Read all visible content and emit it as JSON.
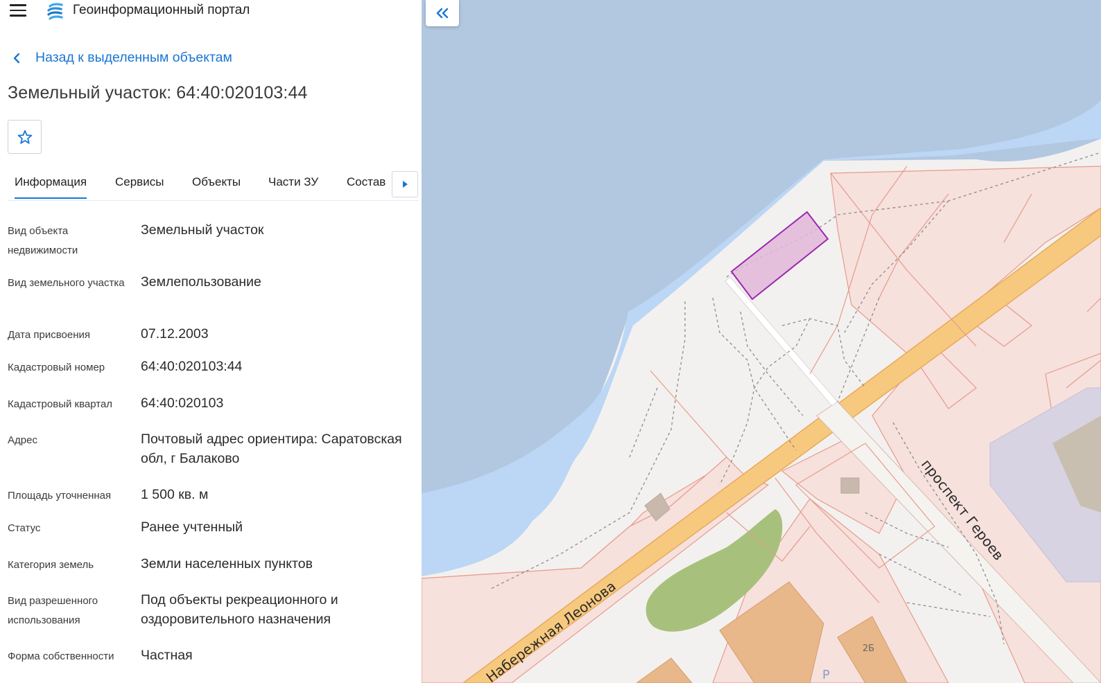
{
  "app": {
    "title": "Геоинформационный портал",
    "icons": {
      "menu": "hamburger-icon",
      "logo": "portal-logo-icon"
    }
  },
  "back_link": {
    "label": "Назад к выделенным объектам",
    "icon": "chevron-left-icon"
  },
  "object": {
    "title": "Земельный участок: 64:40:020103:44",
    "favorite_icon": "star-outline-icon"
  },
  "tabs": {
    "items": [
      {
        "label": "Информация",
        "active": true
      },
      {
        "label": "Сервисы",
        "active": false
      },
      {
        "label": "Объекты",
        "active": false
      },
      {
        "label": "Части ЗУ",
        "active": false
      },
      {
        "label": "Состав",
        "active": false
      }
    ],
    "next_icon": "caret-right-icon"
  },
  "attributes": [
    {
      "label": "Вид объекта недвижимости",
      "value": "Земельный участок"
    },
    {
      "label": "Вид земельного участка",
      "value": "Землепользование"
    },
    {
      "label": "Дата присвоения",
      "value": "07.12.2003"
    },
    {
      "label": "Кадастровый номер",
      "value": "64:40:020103:44"
    },
    {
      "label": "Кадастровый квартал",
      "value": "64:40:020103"
    },
    {
      "label": "Адрес",
      "value": "Почтовый адрес ориентира: Саратовская обл, г Балаково"
    },
    {
      "label": "Площадь уточненная",
      "value": "1 500 кв. м"
    },
    {
      "label": "Статус",
      "value": "Ранее учтенный"
    },
    {
      "label": "Категория земель",
      "value": "Земли населенных пунктов"
    },
    {
      "label": "Вид разрешенного использования",
      "value": "Под объекты рекреационного и оздоровительного назначения"
    },
    {
      "label": "Форма собственности",
      "value": "Частная"
    }
  ],
  "map": {
    "collapse_icon": "double-chevron-left-icon",
    "labels": {
      "street_1": "проспект Героев",
      "street_2": "Набережная Леонова",
      "house": "2Б",
      "parking": "P"
    },
    "colors": {
      "water_deep": "#b2c7e0",
      "water_shallow": "#bcd6f5",
      "land": "#f3f1ef",
      "parcel_fill": "#f6e1dd",
      "parcel_stroke": "#e89a8a",
      "road": "#f7c97e",
      "road_border": "#e8a85c",
      "park": "#a7c17c",
      "building": "#e9b88a",
      "industrial": "#d8d3e3",
      "selected_parcel_fill": "#e0b7d9",
      "selected_parcel_stroke": "#9c27b0",
      "accent": "#1976d2"
    }
  }
}
